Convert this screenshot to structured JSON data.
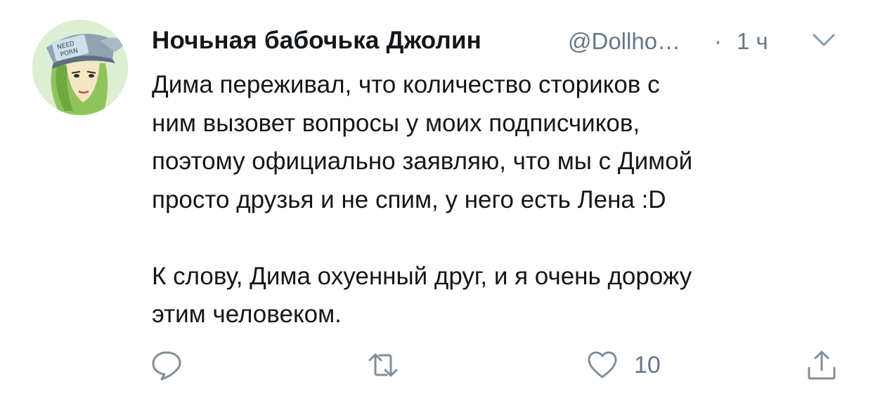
{
  "tweet": {
    "author_name": "Ночьная бабочька Джолин",
    "handle": "@Dollho…",
    "separator": "·",
    "time": "1 ч",
    "text_lines_1": [
      "Дима переживал, что количество сториков с",
      "ним вызовет вопросы у моих подписчиков,",
      "поэтому официально заявляю,  что мы с Димой",
      "просто друзья и не спим, у него есть Лена :D"
    ],
    "text_lines_2": [
      "К слову, Дима охуенный друг, и я очень дорожу",
      "этим человеком."
    ],
    "avatar_cap_text": "NEED PORN"
  },
  "actions": {
    "reply_icon": "speech-bubble-icon",
    "retweet_icon": "retweet-arrows-icon",
    "like_icon": "heart-icon",
    "like_count": "10",
    "share_icon": "share-upload-icon"
  },
  "colors": {
    "text": "#14171a",
    "secondary": "#657786",
    "background": "#ffffff"
  }
}
